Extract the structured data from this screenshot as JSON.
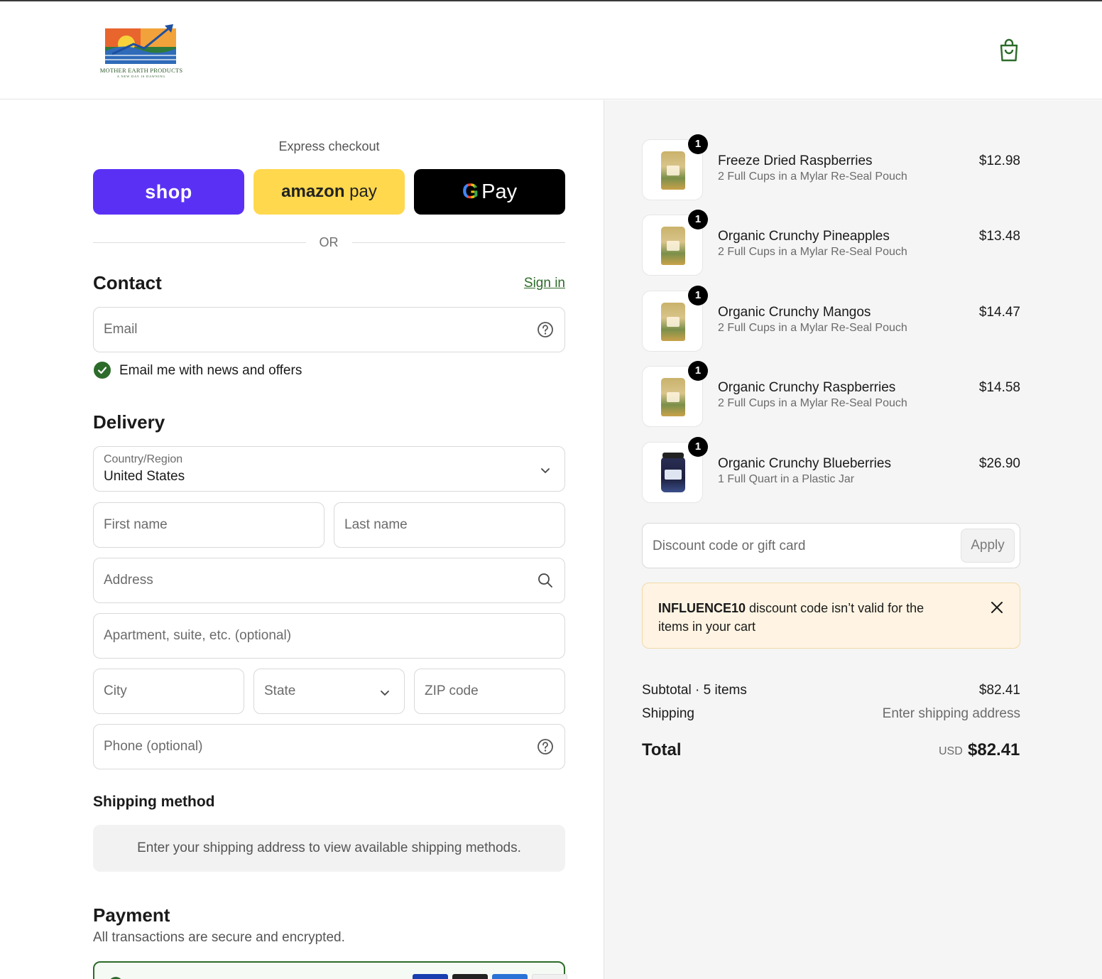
{
  "header": {
    "brand_name": "MOTHER EARTH PRODUCTS",
    "brand_tagline": "A NEW DAY IS DAWNING",
    "cart_icon": "shopping-bag-icon",
    "accent_color": "#2d6b2a"
  },
  "express": {
    "title": "Express checkout",
    "shop_label": "shop",
    "amazon_label_bold": "amazon",
    "amazon_label_light": " pay",
    "gpay_g": "G",
    "gpay_label": "Pay",
    "divider": "OR",
    "colors": {
      "shop": "#5a31f4",
      "amazon": "#ffd84d",
      "gpay": "#000000"
    }
  },
  "contact": {
    "title": "Contact",
    "sign_in": "Sign in",
    "email_placeholder": "Email",
    "newsletter_label": "Email me with news and offers",
    "newsletter_checked": true
  },
  "delivery": {
    "title": "Delivery",
    "country_label": "Country/Region",
    "country_value": "United States",
    "first_name_placeholder": "First name",
    "last_name_placeholder": "Last name",
    "address_placeholder": "Address",
    "apartment_placeholder": "Apartment, suite, etc. (optional)",
    "city_placeholder": "City",
    "state_placeholder": "State",
    "zip_placeholder": "ZIP code",
    "phone_placeholder": "Phone (optional)"
  },
  "shipping_method": {
    "title": "Shipping method",
    "message": "Enter your shipping address to view available shipping methods."
  },
  "payment": {
    "title": "Payment",
    "subtitle": "All transactions are secure and encrypted."
  },
  "cart": {
    "items": [
      {
        "qty": "1",
        "name": "Freeze Dried Raspberries",
        "variant": "2 Full Cups in a Mylar Re-Seal Pouch",
        "price": "$12.98"
      },
      {
        "qty": "1",
        "name": "Organic Crunchy Pineapples",
        "variant": "2 Full Cups in a Mylar Re-Seal Pouch",
        "price": "$13.48"
      },
      {
        "qty": "1",
        "name": "Organic Crunchy Mangos",
        "variant": "2 Full Cups in a Mylar Re-Seal Pouch",
        "price": "$14.47"
      },
      {
        "qty": "1",
        "name": "Organic Crunchy Raspberries",
        "variant": "2 Full Cups in a Mylar Re-Seal Pouch",
        "price": "$14.58"
      },
      {
        "qty": "1",
        "name": "Organic Crunchy Blueberries",
        "variant": "1 Full Quart in a Plastic Jar",
        "price": "$26.90"
      }
    ],
    "discount_placeholder": "Discount code or gift card",
    "apply_label": "Apply",
    "alert": {
      "code": "INFLUENCE10",
      "message": " discount code isn’t valid for the items in your cart"
    },
    "subtotal_label": "Subtotal · 5 items",
    "subtotal_value": "$82.41",
    "shipping_label": "Shipping",
    "shipping_value": "Enter shipping address",
    "total_label": "Total",
    "total_currency": "USD",
    "total_value": "$82.41"
  }
}
